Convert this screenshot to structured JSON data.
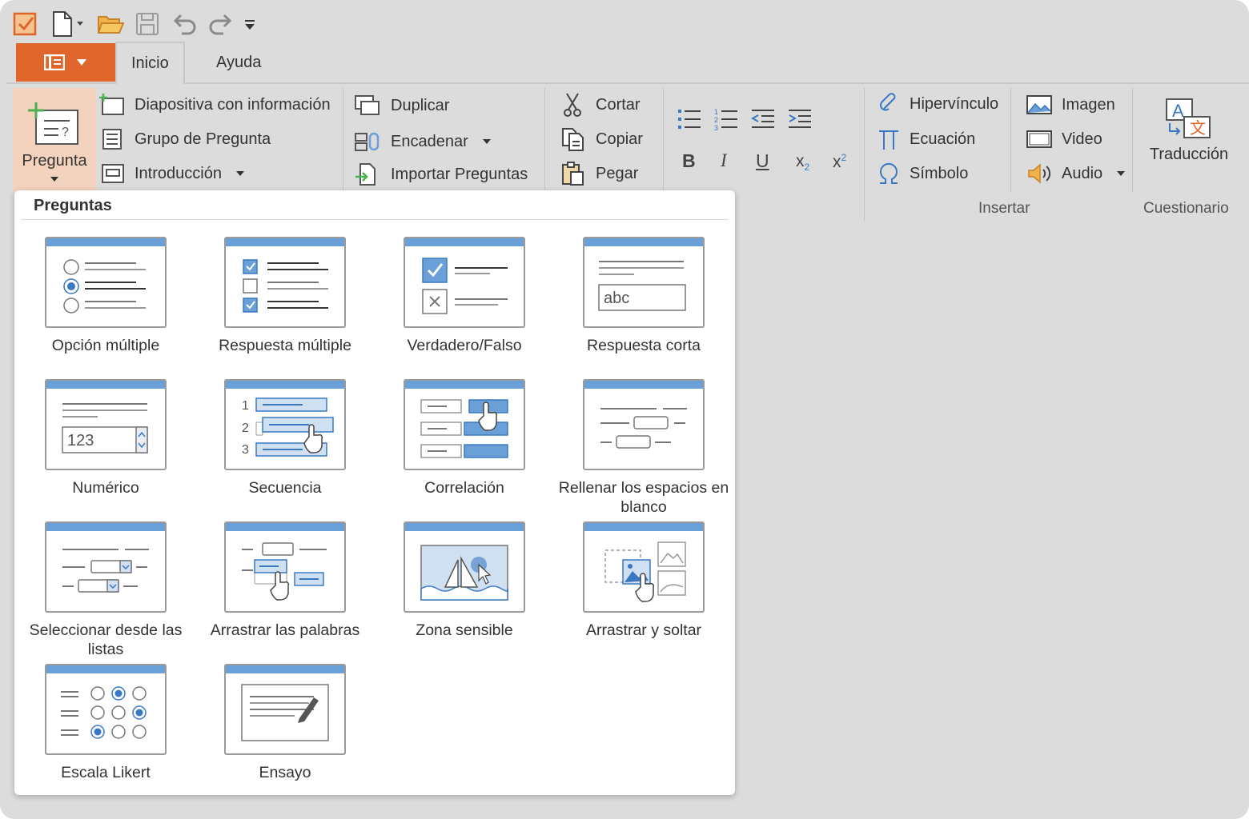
{
  "quick_access": {
    "icons": [
      "app-logo-icon",
      "new-file-icon",
      "open-folder-icon",
      "save-icon",
      "undo-icon",
      "redo-icon",
      "customize-icon"
    ]
  },
  "tabs": [
    {
      "label": "Inicio"
    },
    {
      "label": "Ayuda"
    }
  ],
  "ribbon": {
    "pregunta_label": "Pregunta",
    "slides": {
      "info": "Diapositiva con información",
      "group": "Grupo de Pregunta",
      "intro": "Introducción"
    },
    "edit": {
      "duplicate": "Duplicar",
      "chain": "Encadenar",
      "import": "Importar Preguntas"
    },
    "clipboard": {
      "cut": "Cortar",
      "copy": "Copiar",
      "paste": "Pegar"
    },
    "format": {
      "bold": "B",
      "italic": "I",
      "underline": "U",
      "sub_base": "x",
      "sub": "2",
      "sup_base": "x",
      "sup": "2"
    },
    "insert": {
      "hyperlink": "Hipervínculo",
      "equation": "Ecuación",
      "symbol": "Símbolo",
      "image": "Imagen",
      "video": "Video",
      "audio": "Audio",
      "group_label": "Insertar"
    },
    "quiz": {
      "translation": "Traducción",
      "group_label": "Cuestionario"
    }
  },
  "panel": {
    "title": "Preguntas",
    "items": [
      {
        "label": "Opción múltiple"
      },
      {
        "label": "Respuesta múltiple"
      },
      {
        "label": "Verdadero/Falso"
      },
      {
        "label": "Respuesta corta",
        "icon_text": "abc"
      },
      {
        "label": "Numérico",
        "icon_text": "123"
      },
      {
        "label": "Secuencia",
        "icon_nums": [
          "1",
          "2",
          "3"
        ]
      },
      {
        "label": "Correlación"
      },
      {
        "label": "Rellenar los espacios en blanco"
      },
      {
        "label": "Seleccionar desde las listas"
      },
      {
        "label": "Arrastrar las palabras"
      },
      {
        "label": "Zona sensible"
      },
      {
        "label": "Arrastrar y soltar"
      },
      {
        "label": "Escala Likert"
      },
      {
        "label": "Ensayo"
      }
    ]
  },
  "colors": {
    "accent": "#e0652b",
    "accent_light": "#f3d3be",
    "icon_blue": "#6a9fd8",
    "ribbon_bg": "#dcdcdc"
  }
}
